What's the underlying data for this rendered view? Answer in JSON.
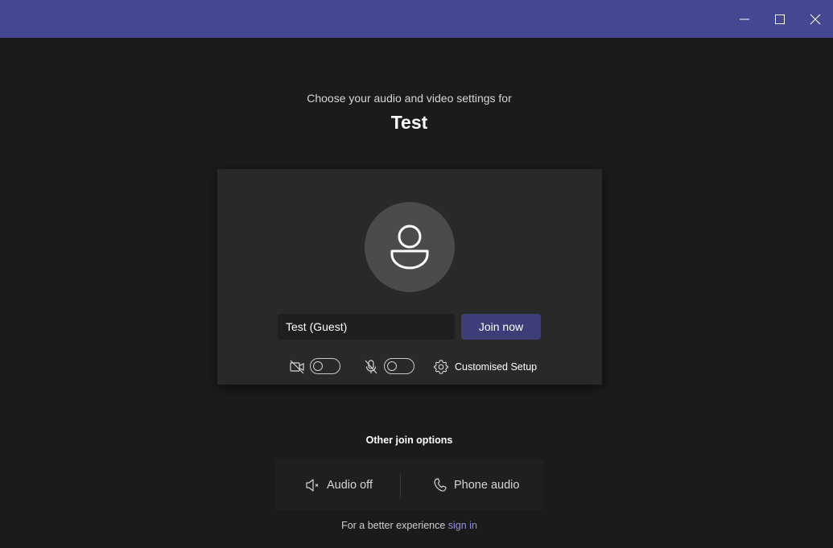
{
  "window": {
    "controls": [
      {
        "name": "minimize-icon",
        "label": "Minimize"
      },
      {
        "name": "maximize-icon",
        "label": "Maximize"
      },
      {
        "name": "close-icon",
        "label": "Close"
      }
    ],
    "titlebar_color": "#444791"
  },
  "header": {
    "subtitle": "Choose your audio and video settings for",
    "meeting_title": "Test"
  },
  "preview": {
    "avatar_icon": "person-icon",
    "name_input": {
      "value": "Test (Guest)",
      "placeholder": "Type your name"
    },
    "join_label": "Join now",
    "join_color": "#3d3e78",
    "camera": {
      "icon": "camera-off-icon",
      "state": "off"
    },
    "microphone": {
      "icon": "mic-off-icon",
      "state": "off"
    },
    "setup_label": "Customised Setup",
    "setup_icon": "gear-icon"
  },
  "other_options": {
    "title": "Other join options",
    "items": [
      {
        "icon": "speaker-off-icon",
        "label": "Audio off"
      },
      {
        "icon": "phone-icon",
        "label": "Phone audio"
      }
    ]
  },
  "footer": {
    "text": "For a better experience",
    "link": "sign in",
    "link_color": "#8f92e0"
  }
}
